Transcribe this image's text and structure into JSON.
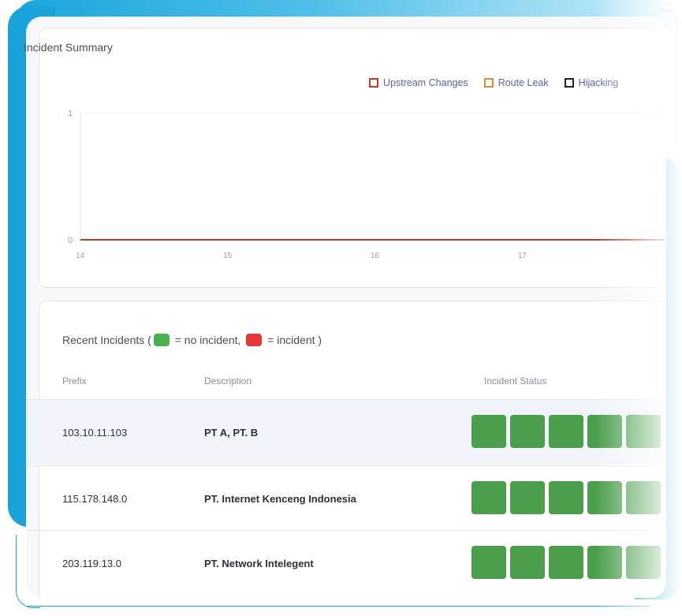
{
  "summary": {
    "title": "Incident Summary",
    "legend": [
      {
        "label": "Upstream Changes",
        "color": "#c0392b"
      },
      {
        "label": "Route Leak",
        "color": "#e08a3c"
      },
      {
        "label": "Hijacking",
        "color": "#222222"
      }
    ],
    "chart_data": {
      "type": "line",
      "x": [
        14,
        15,
        16,
        17
      ],
      "ylim": [
        0,
        1
      ],
      "y_ticks": [
        "0",
        "1"
      ],
      "x_ticks": [
        "14",
        "15",
        "16",
        "17"
      ],
      "series": [
        {
          "name": "Upstream Changes",
          "values": [
            0,
            0,
            0,
            0
          ],
          "color": "#c0392b"
        },
        {
          "name": "Route Leak",
          "values": [
            0,
            0,
            0,
            0
          ],
          "color": "#e08a3c"
        },
        {
          "name": "Hijacking",
          "values": [
            0,
            0,
            0,
            0
          ],
          "color": "#222222"
        }
      ]
    }
  },
  "incidents": {
    "title_prefix": "Recent Incidents (",
    "no_incident_label": " = no incident, ",
    "incident_label": " = incident )",
    "no_incident_color": "#4caf50",
    "incident_color": "#e53935",
    "columns": [
      "Prefix",
      "Description",
      "Incident Status"
    ],
    "rows": [
      {
        "prefix": "103.10.11.103",
        "description": "PT A, PT. B",
        "status": [
          "ok",
          "ok",
          "ok",
          "ok",
          "ok"
        ]
      },
      {
        "prefix": "115.178.148.0",
        "description": "PT. Internet Kenceng Indonesia",
        "status": [
          "ok",
          "ok",
          "ok",
          "ok",
          "ok"
        ]
      },
      {
        "prefix": "203.119.13.0",
        "description": "PT. Network Intelegent",
        "status": [
          "ok",
          "ok",
          "ok",
          "ok",
          "ok"
        ]
      }
    ]
  }
}
